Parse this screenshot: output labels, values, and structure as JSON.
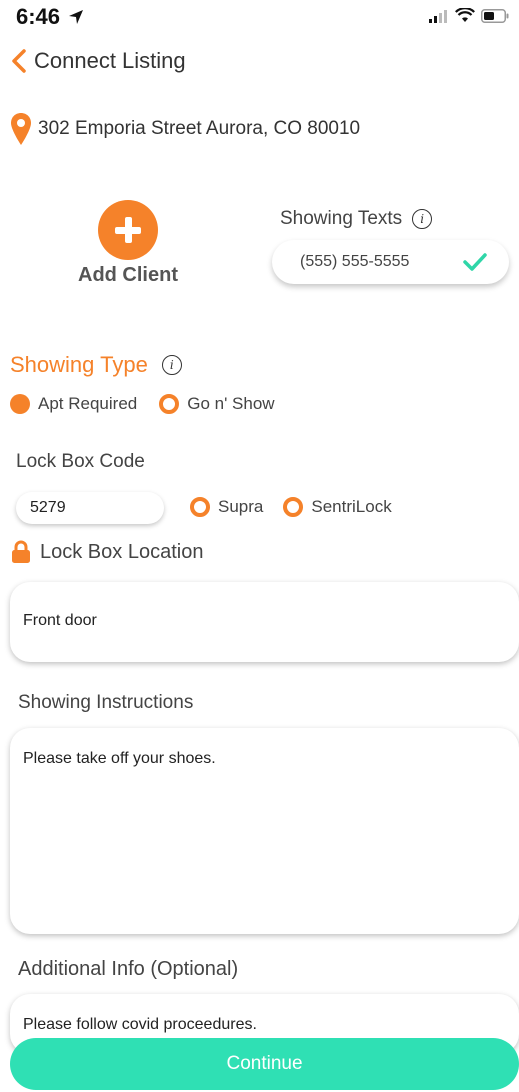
{
  "status_bar": {
    "time": "6:46"
  },
  "header": {
    "title": "Connect Listing"
  },
  "address": "302 Emporia Street Aurora, CO 80010",
  "add_client": {
    "label": "Add Client"
  },
  "showing_texts": {
    "label": "Showing Texts",
    "phone": "(555) 555-5555"
  },
  "showing_type": {
    "title": "Showing Type",
    "options": [
      {
        "label": "Apt Required",
        "selected": true
      },
      {
        "label": "Go n' Show",
        "selected": false
      }
    ]
  },
  "lock_box": {
    "code_label": "Lock Box Code",
    "code_value": "5279",
    "brands": [
      {
        "label": "Supra",
        "selected": false
      },
      {
        "label": "SentriLock",
        "selected": false
      }
    ],
    "location_label": "Lock Box Location",
    "location_value": "Front door"
  },
  "instructions": {
    "label": "Showing Instructions",
    "value": "Please take off your shoes."
  },
  "additional": {
    "label": "Additional Info (Optional)",
    "value": "Please follow covid proceedures."
  },
  "continue_label": "Continue",
  "colors": {
    "accent": "#F5822A",
    "continue": "#2FE0B4",
    "check": "#2FD6A8"
  }
}
